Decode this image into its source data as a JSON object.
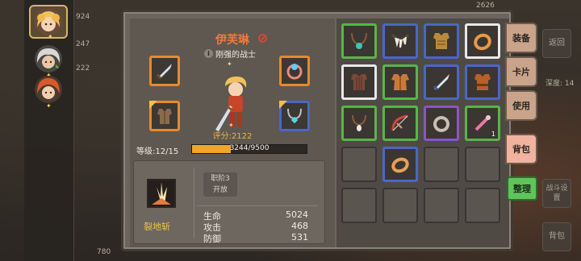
{
  "background": {
    "left_numbers": [
      "924",
      "247",
      "222"
    ],
    "top_right_number": "2626",
    "top_left_number": "780",
    "depth_text": "深度: 14"
  },
  "hero_sidebar": [
    {
      "name": "hero-1",
      "selected": true
    },
    {
      "name": "hero-2",
      "selected": false
    },
    {
      "name": "hero-3",
      "selected": false
    }
  ],
  "hero": {
    "name": "伊芙琳",
    "title": "刚强的战士",
    "score_text": "评分:2122",
    "level_text": "等级:12/15",
    "xp_text": "3244/9500",
    "xp_current": 3244,
    "xp_max": 9500
  },
  "skill": {
    "name": "裂地斩",
    "stage_line1": "职阶3",
    "stage_line2": "开放"
  },
  "stats": [
    {
      "label": "生命",
      "value": "5024"
    },
    {
      "label": "攻击",
      "value": "468"
    },
    {
      "label": "防御",
      "value": "531"
    }
  ],
  "inventory_item_count": "1",
  "tabs": {
    "equip": "装备",
    "card": "卡片",
    "use": "使用",
    "bag": "背包",
    "sort": "整理"
  },
  "far_buttons": {
    "back": "返回",
    "battle_settings": "战斗设置",
    "bag": "背包"
  }
}
